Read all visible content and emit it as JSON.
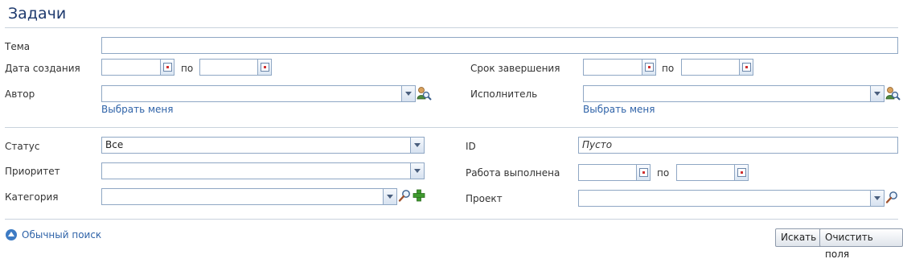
{
  "page": {
    "title": "Задачи"
  },
  "fields": {
    "topic": {
      "label": "Тема",
      "value": ""
    },
    "created_date": {
      "label": "Дата создания",
      "from": "",
      "to": "",
      "to_label": "по"
    },
    "due_date": {
      "label": "Срок завершения",
      "from": "",
      "to": "",
      "to_label": "по"
    },
    "author": {
      "label": "Автор",
      "value": "",
      "select_me": "Выбрать меня"
    },
    "assignee": {
      "label": "Исполнитель",
      "value": "",
      "select_me": "Выбрать меня"
    },
    "status": {
      "label": "Статус",
      "value": "Все"
    },
    "id": {
      "label": "ID",
      "value": "Пусто"
    },
    "priority": {
      "label": "Приоритет",
      "value": ""
    },
    "work_done": {
      "label": "Работа выполнена",
      "from": "",
      "to": "",
      "to_label": "по"
    },
    "category": {
      "label": "Категория",
      "value": ""
    },
    "project": {
      "label": "Проект",
      "value": ""
    }
  },
  "footer": {
    "simple_search": "Обычный поиск",
    "search_button": "Искать",
    "clear_button": "Очистить поля"
  },
  "icons": {
    "user_search": "user-search-icon",
    "search": "magnifier-icon",
    "add": "plus-icon",
    "calendar": "calendar-icon",
    "collapse": "collapse-up-icon"
  },
  "colors": {
    "title": "#1e3a6e",
    "link": "#2f63a8",
    "border": "#8fa7c4",
    "add_icon": "#3f9a2f"
  }
}
